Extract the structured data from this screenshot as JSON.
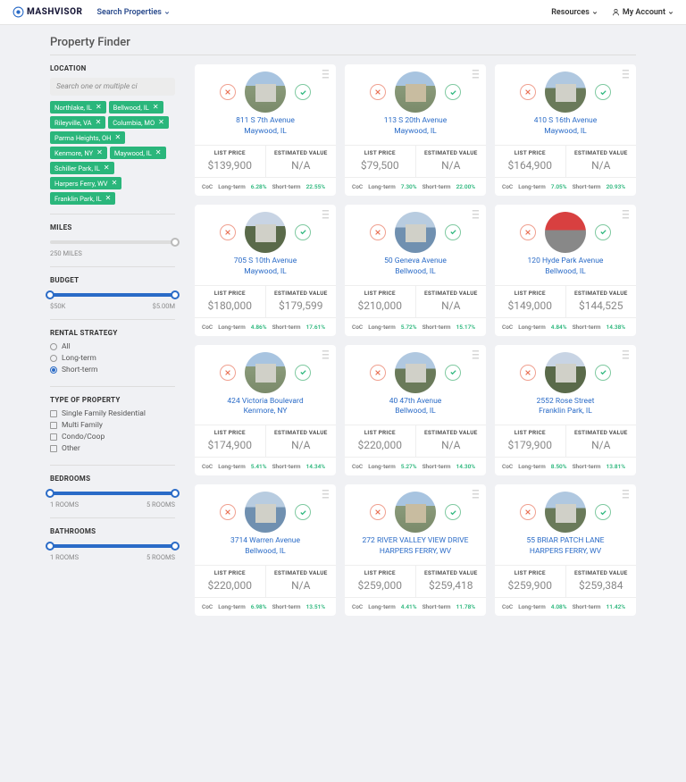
{
  "brand": "MASHVISOR",
  "nav": {
    "search": "Search Properties",
    "resources": "Resources",
    "account": "My Account"
  },
  "page_title": "Property Finder",
  "filters": {
    "location": {
      "label": "LOCATION",
      "placeholder": "Search one or multiple ci",
      "chips": [
        "Northlake, IL",
        "Bellwood, IL",
        "Rileyville, VA",
        "Columbia, MO",
        "Parma Heights, OH",
        "Kenmore, NY",
        "Maywood, IL",
        "Schiller Park, IL",
        "Harpers Ferry, WV",
        "Franklin Park, IL"
      ]
    },
    "miles": {
      "label": "MILES",
      "value": "250 MILES"
    },
    "budget": {
      "label": "BUDGET",
      "min": "$50K",
      "max": "$5.00M"
    },
    "rental": {
      "label": "RENTAL STRATEGY",
      "options": [
        "All",
        "Long-term",
        "Short-term"
      ],
      "selected": "Short-term"
    },
    "type": {
      "label": "TYPE OF PROPERTY",
      "options": [
        "Single Family Residential",
        "Multi Family",
        "Condo/Coop",
        "Other"
      ]
    },
    "bedrooms": {
      "label": "BEDROOMS",
      "min": "1 ROOMS",
      "max": "5 ROOMS"
    },
    "bathrooms": {
      "label": "BATHROOMS",
      "min": "1 ROOMS",
      "max": "5 ROOMS"
    }
  },
  "card_labels": {
    "list": "LIST PRICE",
    "est": "ESTIMATED VALUE",
    "coc": "CoC",
    "lt": "Long-term",
    "st": "Short-term"
  },
  "properties": [
    {
      "addr1": "811 S 7th Avenue",
      "addr2": "Maywood, IL",
      "list": "$139,900",
      "est": "N/A",
      "lt": "6.28%",
      "st": "22.55%",
      "t": "t1"
    },
    {
      "addr1": "113 S 20th Avenue",
      "addr2": "Maywood, IL",
      "list": "$79,500",
      "est": "N/A",
      "lt": "7.30%",
      "st": "22.00%",
      "t": "t2"
    },
    {
      "addr1": "410 S 16th Avenue",
      "addr2": "Maywood, IL",
      "list": "$164,900",
      "est": "N/A",
      "lt": "7.05%",
      "st": "20.93%",
      "t": "t3"
    },
    {
      "addr1": "705 S 10th Avenue",
      "addr2": "Maywood, IL",
      "list": "$180,000",
      "est": "$179,599",
      "lt": "4.86%",
      "st": "17.61%",
      "t": "t4"
    },
    {
      "addr1": "50 Geneva Avenue",
      "addr2": "Bellwood, IL",
      "list": "$210,000",
      "est": "N/A",
      "lt": "5.72%",
      "st": "15.17%",
      "t": "t6"
    },
    {
      "addr1": "120 Hyde Park Avenue",
      "addr2": "Bellwood, IL",
      "list": "$149,000",
      "est": "$144,525",
      "lt": "4.84%",
      "st": "14.38%",
      "t": "t5"
    },
    {
      "addr1": "424 Victoria Boulevard",
      "addr2": "Kenmore, NY",
      "list": "$174,900",
      "est": "N/A",
      "lt": "5.41%",
      "st": "14.34%",
      "t": "t1"
    },
    {
      "addr1": "40 47th Avenue",
      "addr2": "Bellwood, IL",
      "list": "$220,000",
      "est": "N/A",
      "lt": "5.27%",
      "st": "14.30%",
      "t": "t3"
    },
    {
      "addr1": "2552 Rose Street",
      "addr2": "Franklin Park, IL",
      "list": "$179,900",
      "est": "N/A",
      "lt": "8.50%",
      "st": "13.81%",
      "t": "t4"
    },
    {
      "addr1": "3714 Warren Avenue",
      "addr2": "Bellwood, IL",
      "list": "$220,000",
      "est": "N/A",
      "lt": "6.98%",
      "st": "13.51%",
      "t": "t6"
    },
    {
      "addr1": "272 RIVER VALLEY VIEW DRIVE",
      "addr2": "HARPERS FERRY, WV",
      "list": "$259,000",
      "est": "$259,418",
      "lt": "4.41%",
      "st": "11.78%",
      "t": "t2"
    },
    {
      "addr1": "55 BRIAR PATCH LANE",
      "addr2": "HARPERS FERRY, WV",
      "list": "$259,900",
      "est": "$259,384",
      "lt": "4.08%",
      "st": "11.42%",
      "t": "t3"
    }
  ]
}
